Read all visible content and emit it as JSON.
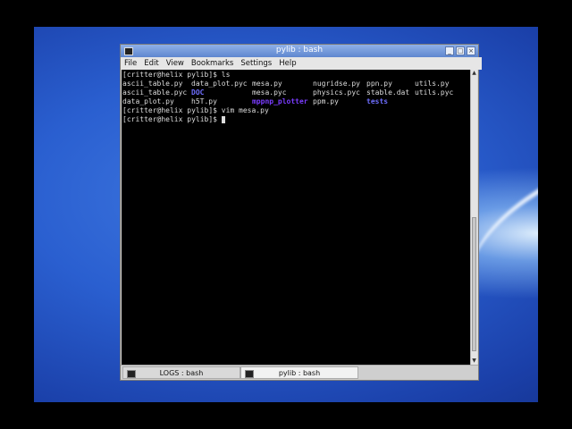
{
  "window": {
    "title": "pylib : bash",
    "buttons": [
      "_",
      "□",
      "×"
    ]
  },
  "menu": [
    "File",
    "Edit",
    "View",
    "Bookmarks",
    "Settings",
    "Help"
  ],
  "terminal": {
    "prompt_ls": "[critter@helix pylib]$ ls",
    "ls_rows": [
      [
        "ascii_table.py",
        "data_plot.pyc",
        "mesa.py",
        "nugridse.py",
        "ppn.py",
        "utils.py"
      ],
      [
        "ascii_table.pyc",
        "DOC",
        "mesa.pyc",
        "physics.pyc",
        "stable.dat",
        "utils.pyc"
      ],
      [
        "data_plot.py",
        "h5T.py",
        "mppnp_plotter",
        "ppm.py",
        "tests",
        ""
      ]
    ],
    "ls_kinds": [
      [
        "file",
        "file",
        "file",
        "file",
        "file",
        "file"
      ],
      [
        "file",
        "dir",
        "file",
        "file",
        "file",
        "file"
      ],
      [
        "file",
        "file",
        "exec",
        "file",
        "dir",
        ""
      ]
    ],
    "prompt_vim": "[critter@helix pylib]$ vim mesa.py",
    "prompt_current": "[critter@helix pylib]$ "
  },
  "tabs": [
    {
      "label": "LOGS : bash",
      "active": false
    },
    {
      "label": "pylib : bash",
      "active": true
    }
  ],
  "colors": {
    "directory": "#6e6eff",
    "executable": "#7a3cff",
    "text": "#dcdcdc"
  }
}
